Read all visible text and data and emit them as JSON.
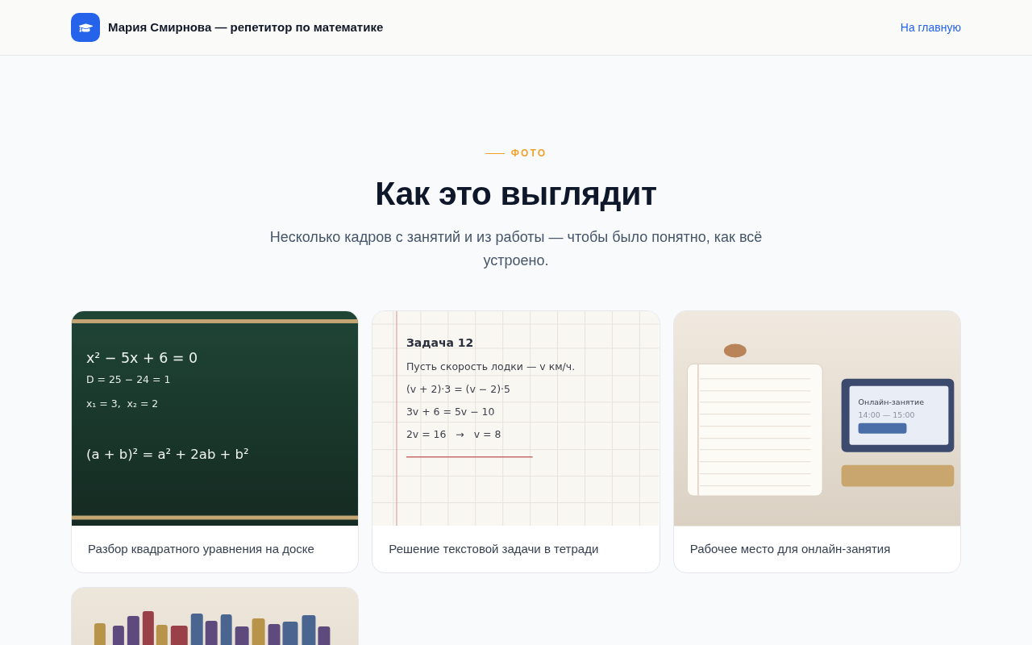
{
  "header": {
    "title": "Мария Смирнова — репетитор по математике",
    "nav_link": "На главную"
  },
  "section": {
    "eyebrow": "ФОТО",
    "title": "Как это выглядит",
    "subtitle": "Несколько кадров с занятий и из работы — чтобы было понятно, как всё устроено."
  },
  "gallery": [
    {
      "kind": "chalkboard",
      "equation": "x² − 5x + 6 = 0",
      "steps": [
        "D = 25 − 24 = 1",
        "x₁ = 3,  x₂ = 2"
      ],
      "identity": "(a + b)² = a² + 2ab + b²",
      "caption": "Разбор квадратного уравнения на доске"
    },
    {
      "kind": "notebook",
      "heading": "Задача 12",
      "lines": [
        "Пусть скорость лодки — v км/ч.",
        "(v + 2)·3 = (v − 2)·5",
        "3v + 6 = 5v − 10",
        "2v = 16   →   v = 8"
      ],
      "caption": "Решение текстовой задачи в тетради"
    },
    {
      "kind": "workspace",
      "screen_title": "Онлайн-занятие",
      "screen_time": "14:00 — 15:00",
      "caption": "Рабочее место для онлайн-занятия"
    },
    {
      "kind": "bookshelf"
    }
  ]
}
